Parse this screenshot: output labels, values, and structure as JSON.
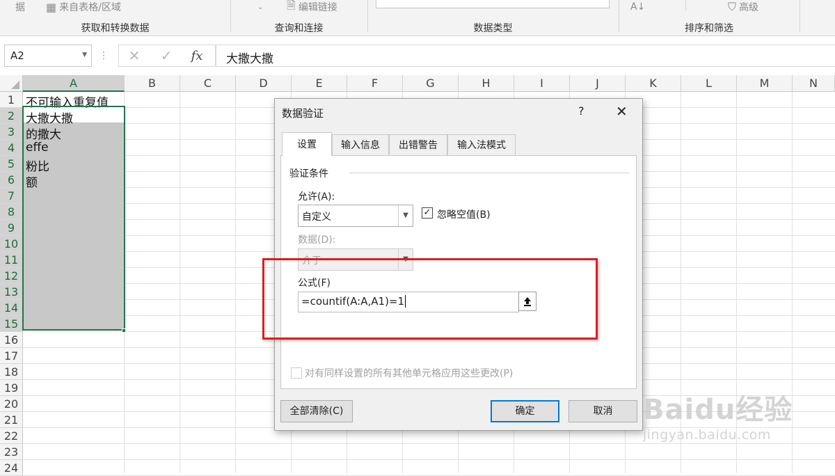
{
  "ribbon": {
    "btn_data_fragment": "据",
    "btn_from_table": "来自表格/区域",
    "btn_edit_links": "编辑链接",
    "btn_sort_az": "A↓",
    "btn_advanced": "高级",
    "group_get_transform": "获取和转换数据",
    "group_queries": "查询和连接",
    "group_data_types": "数据类型",
    "group_sort_filter": "排序和筛选"
  },
  "formula_bar": {
    "name_box": "A2",
    "cancel_glyph": "✕",
    "enter_glyph": "✓",
    "fx_label": "fx",
    "content": "大撒大撒"
  },
  "sheet": {
    "columns": [
      "A",
      "B",
      "C",
      "D",
      "E",
      "F",
      "G",
      "H",
      "I",
      "J",
      "K",
      "L",
      "M",
      "N"
    ],
    "rows": [
      "1",
      "2",
      "3",
      "4",
      "5",
      "6",
      "7",
      "8",
      "9",
      "10",
      "11",
      "12",
      "13",
      "14",
      "15",
      "16",
      "17",
      "18",
      "19",
      "20",
      "21",
      "22",
      "23",
      "24"
    ],
    "cells": [
      "不可输入重复值",
      "大撒大撒",
      "的撒大",
      "effe",
      "粉比",
      "额"
    ],
    "selection_color": "#217346"
  },
  "dialog": {
    "title": "数据验证",
    "help": "?",
    "close": "✕",
    "tabs": [
      "设置",
      "输入信息",
      "出错警告",
      "输入法模式"
    ],
    "section_title": "验证条件",
    "allow_label": "允许(A):",
    "allow_value": "自定义",
    "ignore_blank_label": "忽略空值(B)",
    "ignore_blank_checked": "✓",
    "data_label": "数据(D):",
    "data_value": "介于",
    "formula_label": "公式(F)",
    "formula_value": "=countif(A:A,A1)=1",
    "apply_all_label": "对有同样设置的所有其他单元格应用这些更改(P)",
    "clear_all": "全部清除(C)",
    "ok": "确定",
    "cancel": "取消"
  },
  "highlight_color": "#e21b1b",
  "watermark": {
    "line1": "Baidu经验",
    "line2": "jingyan.baidu.com"
  }
}
